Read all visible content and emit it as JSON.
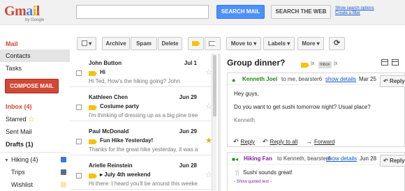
{
  "header": {
    "logo_letters": [
      "G",
      "m",
      "a",
      "i",
      "l"
    ],
    "logo_sub": "by Google",
    "search_placeholder": "",
    "search_mail_label": "SEARCH MAIL",
    "search_web_label": "SEARCH THE WEB",
    "show_options_link": "Show search options",
    "create_filter_link": "Create a filter"
  },
  "nav": {
    "mail": "Mail",
    "contacts": "Contacts",
    "tasks": "Tasks",
    "compose": "COMPOSE MAIL",
    "inbox": "Inbox (4)",
    "starred": "Starred",
    "sent": "Sent Mail",
    "drafts": "Drafts (1)",
    "labels": [
      {
        "label": "Hiking (4)",
        "color": "#3a78d6"
      },
      {
        "label": "Trips",
        "color": "#5a6b85"
      },
      {
        "label": "Wishlist",
        "color": "#f7e7a8"
      }
    ]
  },
  "toolbar": {
    "archive": "Archive",
    "spam": "Spam",
    "delete": "Delete",
    "move_to": "Move to ▾",
    "labels": "Labels ▾",
    "more": "More ▾",
    "refresh": "⟳"
  },
  "messages": [
    {
      "sender": "John Button",
      "date": "Jul 1",
      "subject": "Hi",
      "snippet": "Hi Ted, How's the hiking going? John",
      "starred": false
    },
    {
      "sender": "Kathleen Chen",
      "date": "Jun 29",
      "subject": "Costume party",
      "snippet": "I'm thinking of dressing up as a big pine tree",
      "starred": false
    },
    {
      "sender": "Paul McDonald",
      "date": "Jun 29",
      "subject": "Fun Hike Yesterday!",
      "snippet": "Thanks for the great hike yesterday, it was a",
      "starred": true
    },
    {
      "sender": "Arielle Reinstein",
      "date": "Jun 28",
      "subject": "▸ July 4th weekend",
      "snippet": "Hi there: I heard you'll be around this weeke",
      "starred": false
    }
  ],
  "thread": {
    "title": "Group dinner?",
    "label_inbox": "Inbox",
    "close": "x",
    "message1": {
      "sender": "Kenneth Joel",
      "to": "to me, bearster6",
      "details": "show details",
      "date": "Mar 25",
      "reply": "Reply",
      "body1": "Hey guys,",
      "body2": "Do you want to get sushi tomorrow night?  Usual place?",
      "signature": "Kenneth",
      "action_reply": "Reply",
      "action_reply_all": "Reply to all",
      "action_forward": "Forward"
    },
    "message2": {
      "sender": "Hiking Fan",
      "to": "to Kenneth, bearster6",
      "details": "show details",
      "date": "Jun 28",
      "reply": "Reply",
      "body1": "Sushi sounds great!",
      "quoted": "- Show quoted text -"
    }
  }
}
